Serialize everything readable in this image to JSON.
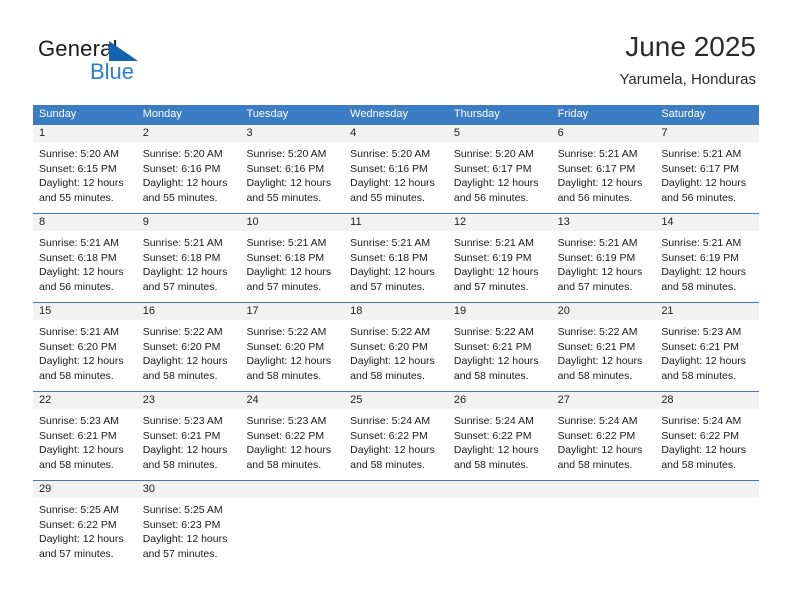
{
  "brand": {
    "name_part1": "General",
    "name_part2": "Blue",
    "triangle_color": "#1263ad",
    "blue_color": "#2a7fc9"
  },
  "header": {
    "title": "June 2025",
    "subtitle": "Yarumela, Honduras"
  },
  "colors": {
    "header_row_bg": "#3b7dc4",
    "day_number_bg": "#f2f2f2",
    "separator": "#3b7dc4",
    "text": "#1a1a1a"
  },
  "weekday_headers": [
    "Sunday",
    "Monday",
    "Tuesday",
    "Wednesday",
    "Thursday",
    "Friday",
    "Saturday"
  ],
  "weeks": [
    [
      {
        "date": "1",
        "sunrise": "Sunrise: 5:20 AM",
        "sunset": "Sunset: 6:15 PM",
        "daylight_line1": "Daylight: 12 hours",
        "daylight_line2": "and 55 minutes."
      },
      {
        "date": "2",
        "sunrise": "Sunrise: 5:20 AM",
        "sunset": "Sunset: 6:16 PM",
        "daylight_line1": "Daylight: 12 hours",
        "daylight_line2": "and 55 minutes."
      },
      {
        "date": "3",
        "sunrise": "Sunrise: 5:20 AM",
        "sunset": "Sunset: 6:16 PM",
        "daylight_line1": "Daylight: 12 hours",
        "daylight_line2": "and 55 minutes."
      },
      {
        "date": "4",
        "sunrise": "Sunrise: 5:20 AM",
        "sunset": "Sunset: 6:16 PM",
        "daylight_line1": "Daylight: 12 hours",
        "daylight_line2": "and 55 minutes."
      },
      {
        "date": "5",
        "sunrise": "Sunrise: 5:20 AM",
        "sunset": "Sunset: 6:17 PM",
        "daylight_line1": "Daylight: 12 hours",
        "daylight_line2": "and 56 minutes."
      },
      {
        "date": "6",
        "sunrise": "Sunrise: 5:21 AM",
        "sunset": "Sunset: 6:17 PM",
        "daylight_line1": "Daylight: 12 hours",
        "daylight_line2": "and 56 minutes."
      },
      {
        "date": "7",
        "sunrise": "Sunrise: 5:21 AM",
        "sunset": "Sunset: 6:17 PM",
        "daylight_line1": "Daylight: 12 hours",
        "daylight_line2": "and 56 minutes."
      }
    ],
    [
      {
        "date": "8",
        "sunrise": "Sunrise: 5:21 AM",
        "sunset": "Sunset: 6:18 PM",
        "daylight_line1": "Daylight: 12 hours",
        "daylight_line2": "and 56 minutes."
      },
      {
        "date": "9",
        "sunrise": "Sunrise: 5:21 AM",
        "sunset": "Sunset: 6:18 PM",
        "daylight_line1": "Daylight: 12 hours",
        "daylight_line2": "and 57 minutes."
      },
      {
        "date": "10",
        "sunrise": "Sunrise: 5:21 AM",
        "sunset": "Sunset: 6:18 PM",
        "daylight_line1": "Daylight: 12 hours",
        "daylight_line2": "and 57 minutes."
      },
      {
        "date": "11",
        "sunrise": "Sunrise: 5:21 AM",
        "sunset": "Sunset: 6:18 PM",
        "daylight_line1": "Daylight: 12 hours",
        "daylight_line2": "and 57 minutes."
      },
      {
        "date": "12",
        "sunrise": "Sunrise: 5:21 AM",
        "sunset": "Sunset: 6:19 PM",
        "daylight_line1": "Daylight: 12 hours",
        "daylight_line2": "and 57 minutes."
      },
      {
        "date": "13",
        "sunrise": "Sunrise: 5:21 AM",
        "sunset": "Sunset: 6:19 PM",
        "daylight_line1": "Daylight: 12 hours",
        "daylight_line2": "and 57 minutes."
      },
      {
        "date": "14",
        "sunrise": "Sunrise: 5:21 AM",
        "sunset": "Sunset: 6:19 PM",
        "daylight_line1": "Daylight: 12 hours",
        "daylight_line2": "and 58 minutes."
      }
    ],
    [
      {
        "date": "15",
        "sunrise": "Sunrise: 5:21 AM",
        "sunset": "Sunset: 6:20 PM",
        "daylight_line1": "Daylight: 12 hours",
        "daylight_line2": "and 58 minutes."
      },
      {
        "date": "16",
        "sunrise": "Sunrise: 5:22 AM",
        "sunset": "Sunset: 6:20 PM",
        "daylight_line1": "Daylight: 12 hours",
        "daylight_line2": "and 58 minutes."
      },
      {
        "date": "17",
        "sunrise": "Sunrise: 5:22 AM",
        "sunset": "Sunset: 6:20 PM",
        "daylight_line1": "Daylight: 12 hours",
        "daylight_line2": "and 58 minutes."
      },
      {
        "date": "18",
        "sunrise": "Sunrise: 5:22 AM",
        "sunset": "Sunset: 6:20 PM",
        "daylight_line1": "Daylight: 12 hours",
        "daylight_line2": "and 58 minutes."
      },
      {
        "date": "19",
        "sunrise": "Sunrise: 5:22 AM",
        "sunset": "Sunset: 6:21 PM",
        "daylight_line1": "Daylight: 12 hours",
        "daylight_line2": "and 58 minutes."
      },
      {
        "date": "20",
        "sunrise": "Sunrise: 5:22 AM",
        "sunset": "Sunset: 6:21 PM",
        "daylight_line1": "Daylight: 12 hours",
        "daylight_line2": "and 58 minutes."
      },
      {
        "date": "21",
        "sunrise": "Sunrise: 5:23 AM",
        "sunset": "Sunset: 6:21 PM",
        "daylight_line1": "Daylight: 12 hours",
        "daylight_line2": "and 58 minutes."
      }
    ],
    [
      {
        "date": "22",
        "sunrise": "Sunrise: 5:23 AM",
        "sunset": "Sunset: 6:21 PM",
        "daylight_line1": "Daylight: 12 hours",
        "daylight_line2": "and 58 minutes."
      },
      {
        "date": "23",
        "sunrise": "Sunrise: 5:23 AM",
        "sunset": "Sunset: 6:21 PM",
        "daylight_line1": "Daylight: 12 hours",
        "daylight_line2": "and 58 minutes."
      },
      {
        "date": "24",
        "sunrise": "Sunrise: 5:23 AM",
        "sunset": "Sunset: 6:22 PM",
        "daylight_line1": "Daylight: 12 hours",
        "daylight_line2": "and 58 minutes."
      },
      {
        "date": "25",
        "sunrise": "Sunrise: 5:24 AM",
        "sunset": "Sunset: 6:22 PM",
        "daylight_line1": "Daylight: 12 hours",
        "daylight_line2": "and 58 minutes."
      },
      {
        "date": "26",
        "sunrise": "Sunrise: 5:24 AM",
        "sunset": "Sunset: 6:22 PM",
        "daylight_line1": "Daylight: 12 hours",
        "daylight_line2": "and 58 minutes."
      },
      {
        "date": "27",
        "sunrise": "Sunrise: 5:24 AM",
        "sunset": "Sunset: 6:22 PM",
        "daylight_line1": "Daylight: 12 hours",
        "daylight_line2": "and 58 minutes."
      },
      {
        "date": "28",
        "sunrise": "Sunrise: 5:24 AM",
        "sunset": "Sunset: 6:22 PM",
        "daylight_line1": "Daylight: 12 hours",
        "daylight_line2": "and 58 minutes."
      }
    ],
    [
      {
        "date": "29",
        "sunrise": "Sunrise: 5:25 AM",
        "sunset": "Sunset: 6:22 PM",
        "daylight_line1": "Daylight: 12 hours",
        "daylight_line2": "and 57 minutes."
      },
      {
        "date": "30",
        "sunrise": "Sunrise: 5:25 AM",
        "sunset": "Sunset: 6:23 PM",
        "daylight_line1": "Daylight: 12 hours",
        "daylight_line2": "and 57 minutes."
      },
      {
        "date": "",
        "sunrise": "",
        "sunset": "",
        "daylight_line1": "",
        "daylight_line2": ""
      },
      {
        "date": "",
        "sunrise": "",
        "sunset": "",
        "daylight_line1": "",
        "daylight_line2": ""
      },
      {
        "date": "",
        "sunrise": "",
        "sunset": "",
        "daylight_line1": "",
        "daylight_line2": ""
      },
      {
        "date": "",
        "sunrise": "",
        "sunset": "",
        "daylight_line1": "",
        "daylight_line2": ""
      },
      {
        "date": "",
        "sunrise": "",
        "sunset": "",
        "daylight_line1": "",
        "daylight_line2": ""
      }
    ]
  ]
}
